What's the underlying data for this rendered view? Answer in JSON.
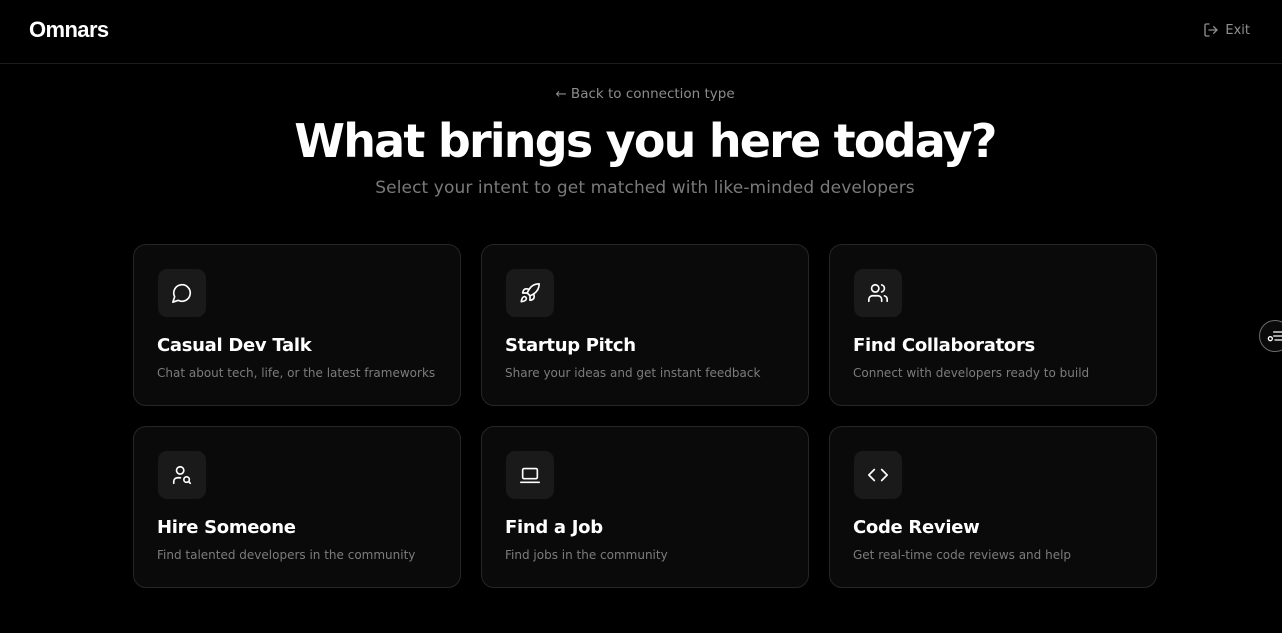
{
  "header": {
    "logo": "Omnars",
    "exit_label": "Exit",
    "exit_icon": "log-out-icon"
  },
  "main": {
    "back_link": "← Back to connection type",
    "title": "What brings you here today?",
    "subtitle": "Select your intent to get matched with like-minded developers"
  },
  "intents": [
    {
      "title": "Casual Dev Talk",
      "description": "Chat about tech, life, or the latest frameworks",
      "icon": "message-circle-icon"
    },
    {
      "title": "Startup Pitch",
      "description": "Share your ideas and get instant feedback",
      "icon": "rocket-icon"
    },
    {
      "title": "Find Collaborators",
      "description": "Connect with developers ready to build",
      "icon": "users-icon"
    },
    {
      "title": "Hire Someone",
      "description": "Find talented developers in the community",
      "icon": "user-search-icon"
    },
    {
      "title": "Find a Job",
      "description": "Find jobs in the community",
      "icon": "laptop-icon"
    },
    {
      "title": "Code Review",
      "description": "Get real-time code reviews and help",
      "icon": "code-icon"
    }
  ],
  "side_button": {
    "icon": "list-settings-icon"
  },
  "colors": {
    "background": "#000000",
    "card": "#0a0a0a",
    "card_border": "#262626",
    "icon_box": "#1a1a1a",
    "muted_text": "#7c7c7c"
  }
}
